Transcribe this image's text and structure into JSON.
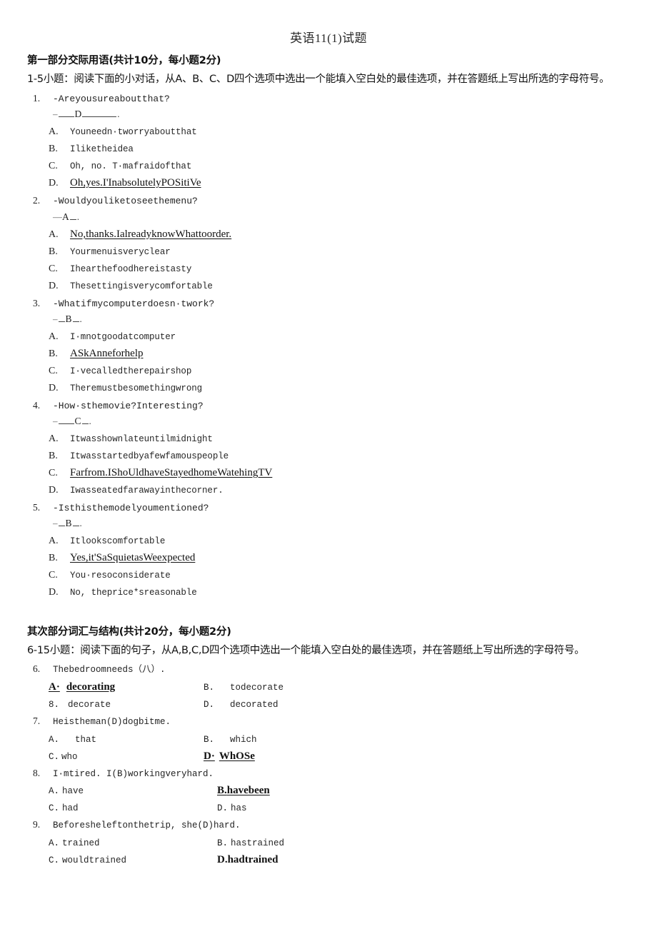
{
  "document": {
    "title": "英语11(1)试题"
  },
  "part1": {
    "heading": "第一部分交际用语(共计10分，每小题2分)",
    "instruction": "1-5小题：阅读下面的小对话，从A、B、C、D四个选项中选出一个能填入空白处的最佳选项，并在答题纸上写出所选的字母符号。",
    "questions": [
      {
        "num": "1.",
        "stem": "-Areyousureaboutthat?",
        "answer": "D",
        "blank_style": "dash-short-letter-long",
        "options": [
          {
            "letter": "A.",
            "text": "Youneedn·tworryaboutthat",
            "chosen": false
          },
          {
            "letter": "B.",
            "text": "Iliketheidea",
            "chosen": false
          },
          {
            "letter": "C.",
            "text": "Oh, no. T·mafraidofthat",
            "chosen": false
          },
          {
            "letter": "D.",
            "text": "Oh,yes.I'InabsolutelyPOSitiVe",
            "chosen": true
          }
        ]
      },
      {
        "num": "2.",
        "stem": "-Wouldyouliketoseethemenu?",
        "answer": "A",
        "blank_style": "doubledash-letter-tiny",
        "options": [
          {
            "letter": "A.",
            "text": "No,thanks.IalreadyknowWhattoorder.",
            "chosen": true
          },
          {
            "letter": "B.",
            "text": "Yourmenuisveryclear",
            "chosen": false
          },
          {
            "letter": "C.",
            "text": "Ihearthefoodhereistasty",
            "chosen": false
          },
          {
            "letter": "D.",
            "text": "Thesettingisverycomfortable",
            "chosen": false
          }
        ]
      },
      {
        "num": "3.",
        "stem": "-Whatifmycomputerdoesn·twork?",
        "answer": "B",
        "blank_style": "dash-tiny-letter-tiny",
        "options": [
          {
            "letter": "A.",
            "text": "I·mnotgoodatcomputer",
            "chosen": false
          },
          {
            "letter": "B.",
            "text": "ASkAnneforhelp",
            "chosen": true
          },
          {
            "letter": "C.",
            "text": "I·vecalledtherepairshop",
            "chosen": false
          },
          {
            "letter": "D.",
            "text": "Theremustbesomethingwrong",
            "chosen": false
          }
        ]
      },
      {
        "num": "4.",
        "stem": "-How·sthemovie?Interesting?",
        "answer": "C",
        "blank_style": "dash-short-letter-tiny",
        "options": [
          {
            "letter": "A.",
            "text": "Itwasshownlateuntilmidnight",
            "chosen": false
          },
          {
            "letter": "B.",
            "text": "Itwasstartedbyafewfamouspeople",
            "chosen": false
          },
          {
            "letter": "C.",
            "text": "Farfrom.IShoUldhaveStayedhomeWatehingTV",
            "chosen": true
          },
          {
            "letter": "D.",
            "text": "Iwasseatedfarawayinthecorner.",
            "chosen": false
          }
        ]
      },
      {
        "num": "5.",
        "stem": "-Isthisthemodelyoumentioned?",
        "answer": "B",
        "blank_style": "dash-tiny-letter-tiny",
        "options": [
          {
            "letter": "A.",
            "text": "Itlookscomfortable",
            "chosen": false
          },
          {
            "letter": "B.",
            "text": "Yes,it'SaSquietasWeexpected",
            "chosen": true
          },
          {
            "letter": "C.",
            "text": "You·resoconsiderate",
            "chosen": false
          },
          {
            "letter": "D.",
            "text": "No, theprice*sreasonable",
            "chosen": false
          }
        ]
      }
    ]
  },
  "part2": {
    "heading": "其次部分词汇与结构(共计20分，每小题2分)",
    "instruction": "6-15小题：阅读下面的句子，从A,B,C,D四个选项中选出一个能填入空白处的最佳选项，并在答题纸上写出所选的字母符号。",
    "questions": [
      {
        "num": "6.",
        "stem": "Thebedroomneeds（八）.",
        "rows": [
          {
            "left": {
              "letter": "A·",
              "text": "decorating",
              "style": "pick"
            },
            "right": {
              "letter": "B.",
              "text": "todecorate",
              "style": "plain"
            }
          },
          {
            "left": {
              "letter": "8.",
              "text": "decorate",
              "style": "plain"
            },
            "right": {
              "letter": "D.",
              "text": "decorated",
              "style": "plain"
            }
          }
        ]
      },
      {
        "num": "7.",
        "stem": "Heistheman(D)dogbitme.",
        "rows": [
          {
            "left": {
              "letter": "A.",
              "text": "that",
              "style": "plain"
            },
            "right": {
              "letter": "B.",
              "text": "which",
              "style": "plain"
            }
          },
          {
            "left": {
              "letter": "C.",
              "text": "who",
              "style": "plain-tight"
            },
            "right": {
              "letter": "D·",
              "text": "WhOSe",
              "style": "pick"
            }
          }
        ]
      },
      {
        "num": "8.",
        "stem": "I·mtired. I(B)workingveryhard.",
        "rows": [
          {
            "left": {
              "letter": "A.",
              "text": "have",
              "style": "plain-tight"
            },
            "right": {
              "letter": "B.",
              "text": "havebeen",
              "style": "pick-joined"
            }
          },
          {
            "left": {
              "letter": "C.",
              "text": "had",
              "style": "plain-tight"
            },
            "right": {
              "letter": "D.",
              "text": "has",
              "style": "plain-tight"
            }
          }
        ]
      },
      {
        "num": "9.",
        "stem": "Beforesheleftonthetrip, she(D)hard.",
        "rows": [
          {
            "left": {
              "letter": "A.",
              "text": "trained",
              "style": "plain-tight"
            },
            "right": {
              "letter": "B.",
              "text": "hastrained",
              "style": "plain-tight"
            }
          },
          {
            "left": {
              "letter": "C.",
              "text": "wouldtrained",
              "style": "plain-tight"
            },
            "right": {
              "letter": "D.",
              "text": "hadtrained",
              "style": "pick-bold-joined"
            }
          }
        ]
      }
    ]
  }
}
